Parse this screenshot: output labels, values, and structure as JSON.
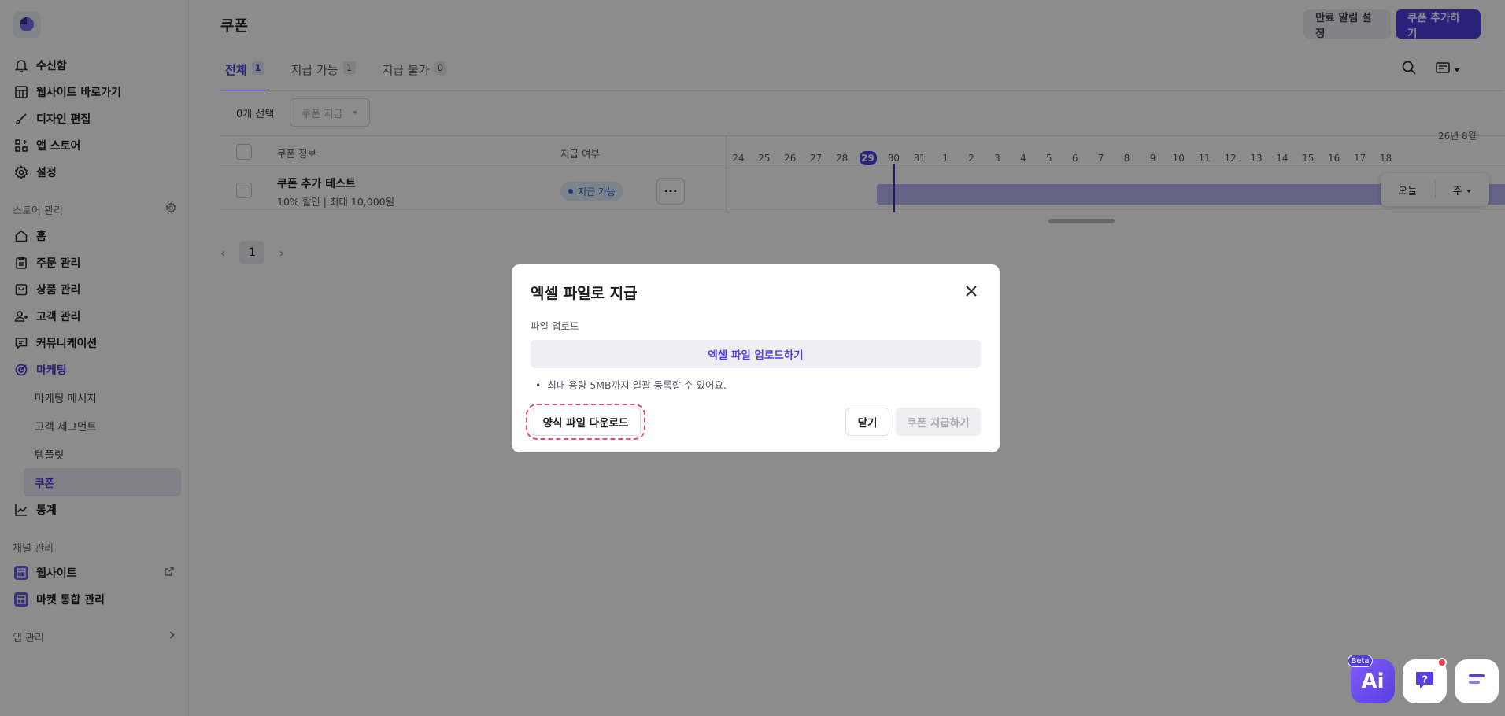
{
  "sidebar": {
    "top_items": [
      {
        "label": "수신함"
      },
      {
        "label": "웹사이트 바로가기"
      },
      {
        "label": "디자인 편집"
      },
      {
        "label": "앱 스토어"
      },
      {
        "label": "설정"
      }
    ],
    "store_section": "스토어 관리",
    "store_items": [
      {
        "label": "홈"
      },
      {
        "label": "주문 관리"
      },
      {
        "label": "상품 관리"
      },
      {
        "label": "고객 관리"
      },
      {
        "label": "커뮤니케이션"
      },
      {
        "label": "마케팅"
      }
    ],
    "marketing_sub": [
      {
        "label": "마케팅 메시지"
      },
      {
        "label": "고객 세그먼트"
      },
      {
        "label": "템플릿"
      },
      {
        "label": "쿠폰"
      }
    ],
    "stats": "통계",
    "channel_section": "채널 관리",
    "channel_items": [
      {
        "label": "웹사이트"
      },
      {
        "label": "마켓 통합 관리"
      }
    ],
    "app_section": "앱 관리"
  },
  "header": {
    "title": "쿠폰",
    "expire_btn": "만료 알림 설정",
    "add_btn": "쿠폰 추가하기"
  },
  "tabs": [
    {
      "label": "전체",
      "count": "1"
    },
    {
      "label": "지급 가능",
      "count": "1"
    },
    {
      "label": "지급 불가",
      "count": "0"
    }
  ],
  "toolbar": {
    "selected": "0개 선택",
    "action_dropdown": "쿠폰 지급"
  },
  "grid": {
    "col_info": "쿠폰 정보",
    "col_status": "지급 여부",
    "month_label": "26년 8월",
    "days": [
      "24",
      "25",
      "26",
      "27",
      "28",
      "29",
      "30",
      "31",
      "1",
      "2",
      "3",
      "4",
      "5",
      "6",
      "7",
      "8",
      "9",
      "10",
      "11",
      "12",
      "13",
      "14",
      "15",
      "16",
      "17",
      "18"
    ],
    "today_day": "29",
    "rows": [
      {
        "name": "쿠폰 추가 테스트",
        "desc": "10% 할인 | 최대 10,000원",
        "status": "지급 가능"
      }
    ],
    "today_btn": "오늘",
    "view_select": "주"
  },
  "pager": {
    "current": "1"
  },
  "modal": {
    "title": "엑셀 파일로 지급",
    "field_label": "파일 업로드",
    "upload_btn": "엑셀 파일 업로드하기",
    "hint": "최대 용량 5MB까지 일괄 등록할 수 있어요.",
    "template_btn": "양식 파일 다운로드",
    "close_btn": "닫기",
    "issue_btn": "쿠폰 지급하기"
  },
  "floating": {
    "ai_label": "Ai",
    "beta_label": "Beta"
  },
  "colors": {
    "accent": "#4f3fe0",
    "overlay": "rgba(0,0,0,0.45)",
    "highlight_ring": "#e0506a"
  }
}
